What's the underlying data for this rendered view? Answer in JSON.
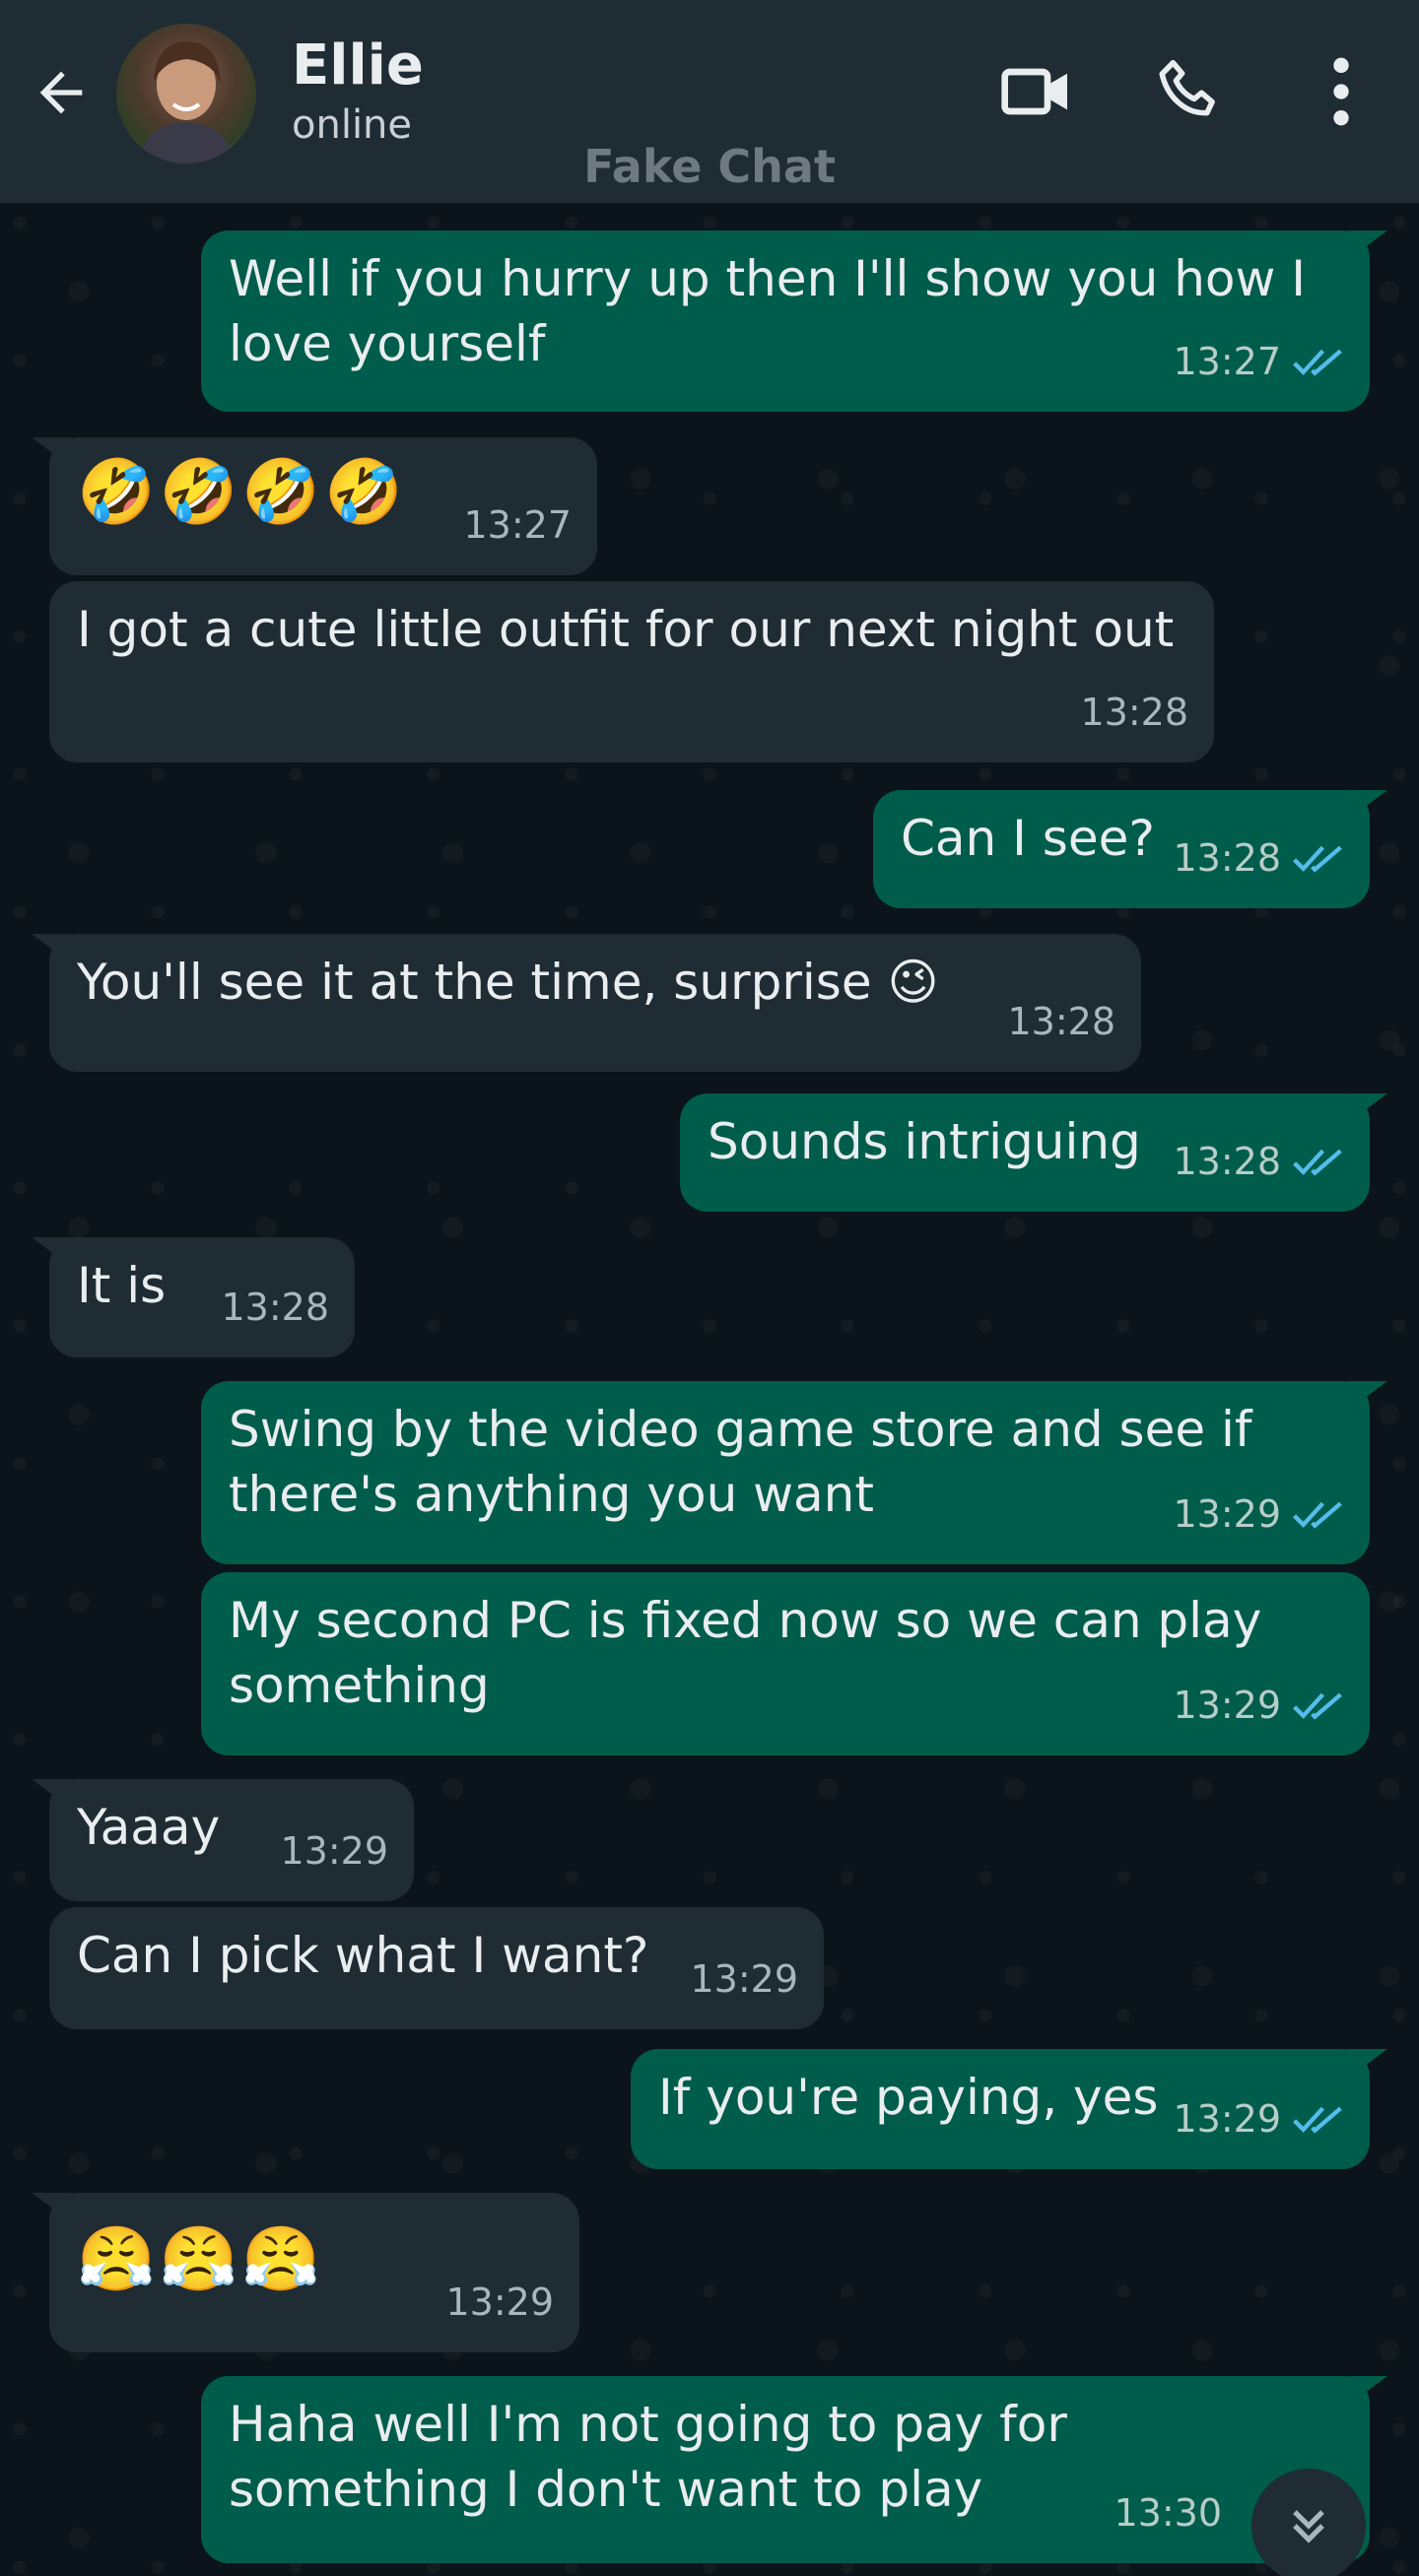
{
  "header": {
    "contact_name": "Ellie",
    "status": "online",
    "watermark": "Fake Chat"
  },
  "messages": [
    {
      "dir": "out",
      "text": "Well if you hurry up then I'll show you how I love yourself",
      "time": "13:27",
      "read": true
    },
    {
      "dir": "in",
      "text": "🤣🤣🤣🤣",
      "time": "13:27"
    },
    {
      "dir": "in",
      "text": "I got a cute little outfit for our next night out",
      "time": "13:28"
    },
    {
      "dir": "out",
      "text": "Can I see?",
      "time": "13:28",
      "read": true
    },
    {
      "dir": "in",
      "text": "You'll see it at the time, surprise 😉",
      "time": "13:28"
    },
    {
      "dir": "out",
      "text": "Sounds intriguing",
      "time": "13:28",
      "read": true
    },
    {
      "dir": "in",
      "text": "It is",
      "time": "13:28"
    },
    {
      "dir": "out",
      "text": "Swing by the video game store and see if there's anything you want",
      "time": "13:29",
      "read": true
    },
    {
      "dir": "out",
      "text": "My second PC is fixed now so we can play something",
      "time": "13:29",
      "read": true
    },
    {
      "dir": "in",
      "text": "Yaaay",
      "time": "13:29"
    },
    {
      "dir": "in",
      "text": "Can I pick what I want?",
      "time": "13:29"
    },
    {
      "dir": "out",
      "text": "If you're paying, yes",
      "time": "13:29",
      "read": true
    },
    {
      "dir": "in",
      "text": "😤😤😤",
      "time": "13:29"
    },
    {
      "dir": "out",
      "text": "Haha well I'm not going to pay for something I don't want to play",
      "time": "13:30",
      "read": true
    }
  ],
  "colors": {
    "header_bg": "#1f2c34",
    "chat_bg": "#0b141a",
    "outgoing_bubble": "#005c4b",
    "incoming_bubble": "#1f2c34",
    "read_ticks": "#53bdeb"
  },
  "icons": [
    "back-arrow-icon",
    "video-call-icon",
    "phone-icon",
    "more-options-icon",
    "double-check-icon",
    "scroll-down-icon"
  ]
}
